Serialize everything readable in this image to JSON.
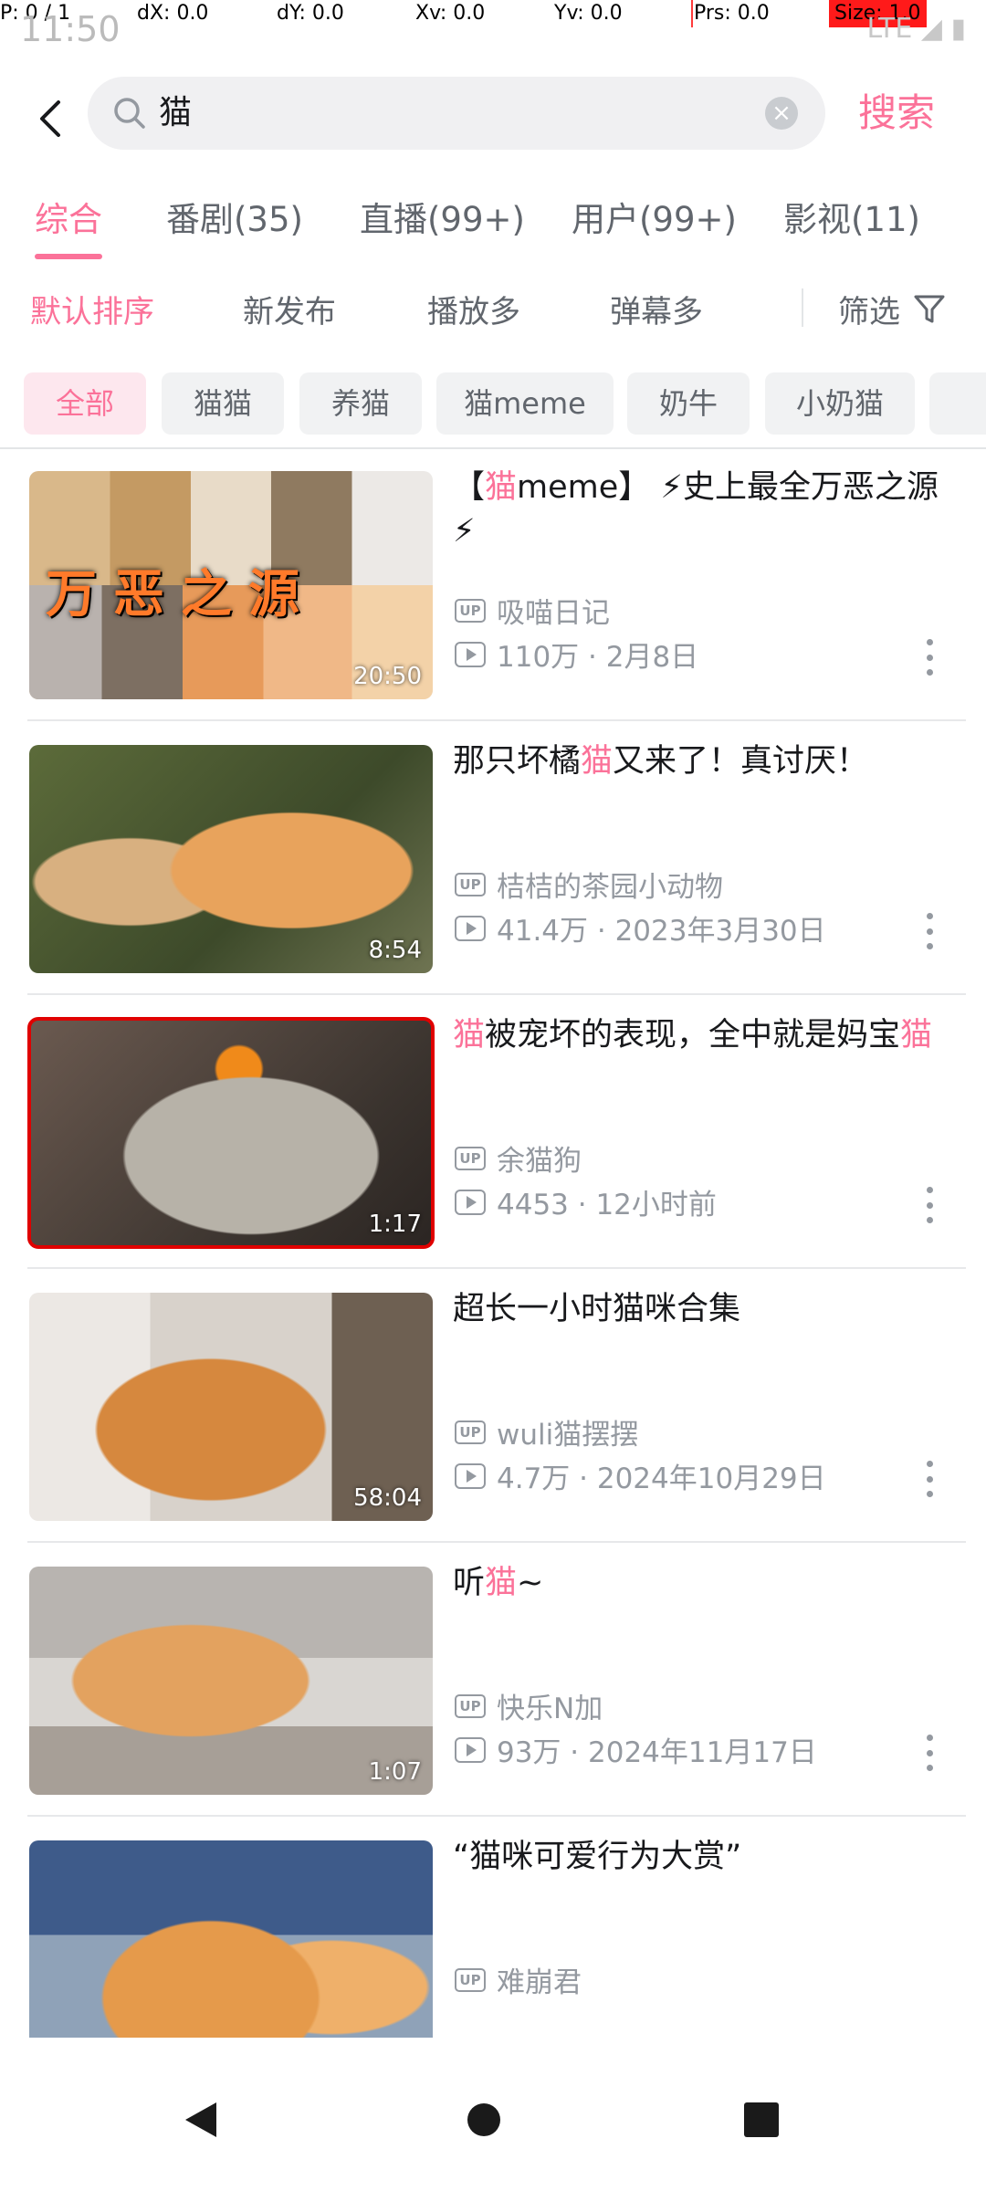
{
  "debug": {
    "pointer": "P: 0 / 1",
    "dx": "dX: 0.0",
    "dy": "dY: 0.0",
    "xv": "Xv: 0.0",
    "yv": "Yv: 0.0",
    "prs": "Prs: 0.0",
    "size": "Size: 1.0"
  },
  "status_bar": {
    "time": "11:50",
    "network": "LTE"
  },
  "search": {
    "query": "猫",
    "button_label": "搜索"
  },
  "tabs": [
    {
      "label": "综合",
      "active": true
    },
    {
      "label": "番剧(35)"
    },
    {
      "label": "直播(99+)"
    },
    {
      "label": "用户(99+)"
    },
    {
      "label": "影视(11)"
    }
  ],
  "sort": {
    "items": [
      "默认排序",
      "新发布",
      "播放多",
      "弹幕多"
    ],
    "active_index": 0,
    "filter_label": "筛选"
  },
  "chips": [
    "全部",
    "猫猫",
    "养猫",
    "猫meme",
    "奶牛",
    "小奶猫"
  ],
  "results": [
    {
      "title_parts": [
        "【",
        "猫",
        "meme】 ⚡史上最全万恶之源⚡"
      ],
      "uploader": "吸喵日记",
      "views": "110万 · 2月8日",
      "duration": "20:50",
      "thumb_overlay": "万恶之源"
    },
    {
      "title_parts": [
        "那只坏橘",
        "猫",
        "又来了！真讨厌！"
      ],
      "uploader": "桔桔的茶园小动物",
      "views": "41.4万 · 2023年3月30日",
      "duration": "8:54"
    },
    {
      "title_parts": [
        "",
        "猫",
        "被宠坏的表现，全中就是妈宝",
        "猫"
      ],
      "uploader": "余猫狗",
      "views": "4453 · 12小时前",
      "duration": "1:17",
      "selected": true
    },
    {
      "title_parts": [
        "超长一小时猫咪合集",
        "",
        ""
      ],
      "uploader": "wuli猫摆摆",
      "views": "4.7万 · 2024年10月29日",
      "duration": "58:04"
    },
    {
      "title_parts": [
        "听",
        "猫",
        "~"
      ],
      "uploader": "快乐N加",
      "views": "93万 · 2024年11月17日",
      "duration": "1:07"
    },
    {
      "title_parts": [
        "“猫咪可爱行为大赏”",
        "",
        ""
      ],
      "uploader": "难崩君"
    }
  ],
  "labels": {
    "up_badge": "UP"
  },
  "colors": {
    "accent": "#fb7299",
    "text": "#18191c",
    "secondary": "#9499a0"
  }
}
